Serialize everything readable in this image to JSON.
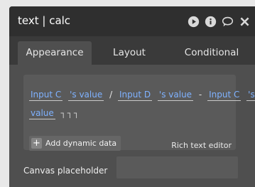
{
  "window": {
    "title": "text | calc",
    "icons": [
      "play-icon",
      "info-icon",
      "comment-icon",
      "close-icon"
    ]
  },
  "tabs": [
    {
      "label": "Appearance",
      "active": true
    },
    {
      "label": "Layout",
      "active": false
    },
    {
      "label": "Conditional",
      "active": false
    }
  ],
  "expression": {
    "line1": [
      {
        "text": "Input C",
        "kind": "chip"
      },
      {
        "text": "'s value",
        "kind": "chip"
      },
      {
        "text": "/",
        "kind": "op"
      },
      {
        "text": "Input D",
        "kind": "chip"
      },
      {
        "text": "'s value",
        "kind": "chip"
      },
      {
        "text": "-",
        "kind": "op"
      },
      {
        "text": "Input C",
        "kind": "chip"
      },
      {
        "text": "'s",
        "kind": "chip"
      }
    ],
    "line2": [
      {
        "text": "value",
        "kind": "chip"
      },
      {
        "text": "┐┐┐",
        "kind": "tail"
      }
    ]
  },
  "buttons": {
    "add_dynamic_data": "Add dynamic data",
    "plus": "+"
  },
  "rich_text_editor_label": "Rich text editor",
  "canvas_placeholder": {
    "label": "Canvas placeholder",
    "value": ""
  },
  "colors": {
    "accent_link": "#7fb2ff",
    "panel_bg": "#4f4f4f",
    "header_bg": "#2f2f2f"
  }
}
